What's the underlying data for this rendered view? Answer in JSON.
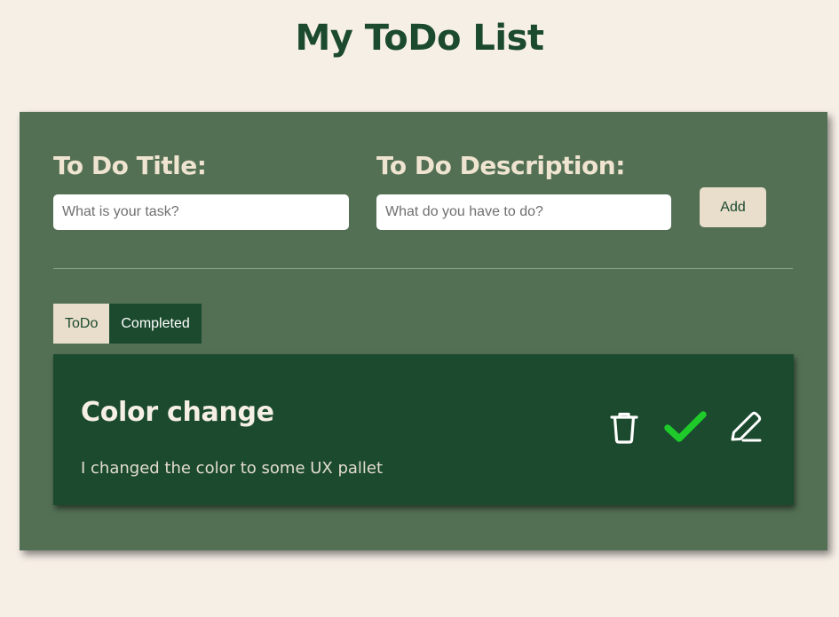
{
  "header": {
    "title": "My ToDo List"
  },
  "form": {
    "title_label": "To Do Title:",
    "title_placeholder": "What is your task?",
    "title_value": "",
    "description_label": "To Do Description:",
    "description_placeholder": "What do you have to do?",
    "description_value": "",
    "add_label": "Add"
  },
  "tabs": [
    {
      "label": "ToDo",
      "active": true
    },
    {
      "label": "Completed",
      "active": false
    }
  ],
  "todos": [
    {
      "title": "Color change",
      "description": "I changed the color to some UX pallet",
      "actions": [
        {
          "icon": "trash-icon",
          "color": "#ffffff"
        },
        {
          "icon": "checkmark-icon",
          "color": "#1ecb2b"
        },
        {
          "icon": "pencil-icon",
          "color": "#ffffff"
        }
      ]
    }
  ],
  "colors": {
    "background": "#f6efe6",
    "panel": "#537054",
    "accent_dark": "#1b4a2e",
    "accent_light": "#e8decb",
    "check": "#1ecb2b"
  }
}
